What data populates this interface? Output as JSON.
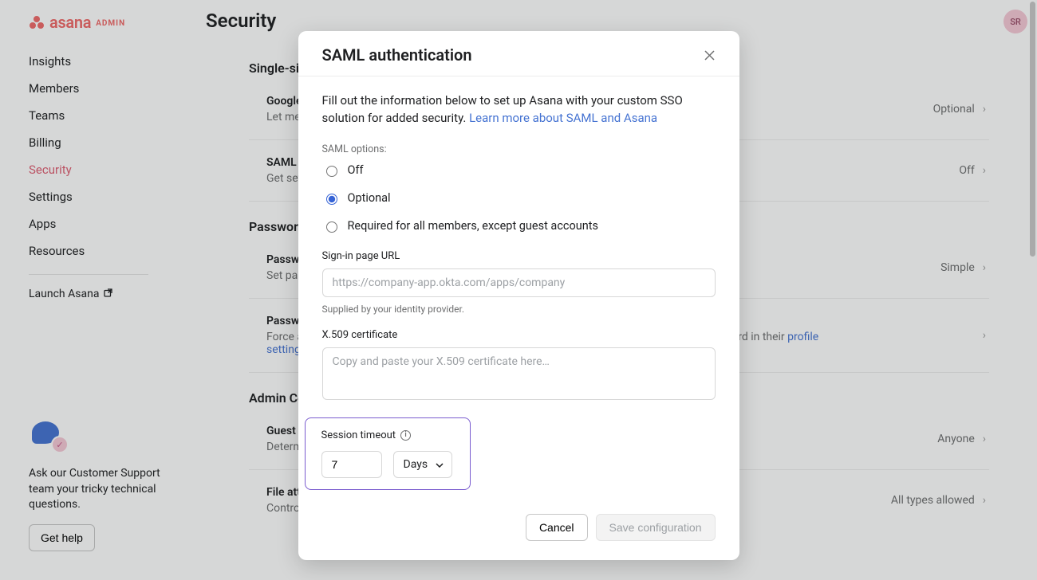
{
  "brand": {
    "name": "asana",
    "admin_tag": "ADMIN"
  },
  "sidebar": {
    "items": [
      {
        "label": "Insights"
      },
      {
        "label": "Members"
      },
      {
        "label": "Teams"
      },
      {
        "label": "Billing"
      },
      {
        "label": "Security"
      },
      {
        "label": "Settings"
      },
      {
        "label": "Apps"
      },
      {
        "label": "Resources"
      }
    ],
    "launch_label": "Launch Asana",
    "help_text": "Ask our Customer Support team your tricky technical questions.",
    "help_button": "Get help"
  },
  "header": {
    "title": "Security",
    "avatar_initials": "SR"
  },
  "sections": {
    "sso": {
      "title": "Single-sign on (SSO)",
      "google": {
        "title": "Google SSO",
        "desc": "Let members and guests connect their Asana account to their work Google account",
        "status": "Optional"
      },
      "saml": {
        "title": "SAML authentication",
        "desc": "Get set up with SAML single-sign on",
        "status": "Off"
      }
    },
    "password": {
      "title": "Password",
      "strength": {
        "title": "Password strength",
        "desc": "Set password requirements for members without SSO or SAML",
        "status": "Simple"
      },
      "reset": {
        "title": "Password reset",
        "desc_prefix": "Force a password reset for all members. Members not using SSO/SAML can reset their password in their ",
        "desc_link": "profile settings",
        "desc_suffix": "."
      }
    },
    "admin": {
      "title": "Admin Controls",
      "guest": {
        "title": "Guest invite permissions",
        "desc": "Determine who can invite guests",
        "status": "Anyone"
      },
      "file": {
        "title": "File attachment options",
        "desc": "Control which file attachment types should be used in your Organization",
        "status": "All types allowed"
      }
    }
  },
  "modal": {
    "title": "SAML authentication",
    "desc": "Fill out the information below to set up Asana with your custom SSO solution for added security. ",
    "learn_more": "Learn more about SAML and Asana",
    "options_label": "SAML options:",
    "options": {
      "off": "Off",
      "optional": "Optional",
      "required": "Required for all members, except guest accounts"
    },
    "signin_label": "Sign-in page URL",
    "signin_placeholder": "https://company-app.okta.com/apps/company",
    "signin_hint": "Supplied by your identity provider.",
    "cert_label": "X.509 certificate",
    "cert_placeholder": "Copy and paste your X.509 certificate here…",
    "session_label": "Session timeout",
    "session_value": "7",
    "session_unit": "Days",
    "cancel": "Cancel",
    "save": "Save configuration"
  }
}
